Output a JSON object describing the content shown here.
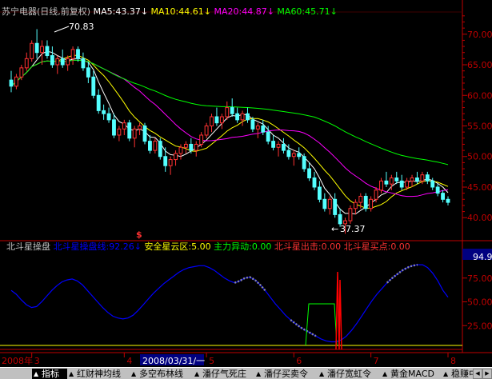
{
  "main_panel": {
    "stock_name": "苏宁电器",
    "period": "(日线,前复权)",
    "ma5": {
      "label": "MA5:",
      "value": "43.37",
      "color": "#ffffff"
    },
    "ma10": {
      "label": "MA10:",
      "value": "44.61",
      "color": "#ffff00"
    },
    "ma20": {
      "label": "MA20:",
      "value": "44.87",
      "color": "#ff00ff"
    },
    "ma60": {
      "label": "MA60:",
      "value": "45.71",
      "color": "#00ff00"
    },
    "high_marker": "70.83",
    "low_marker": "37.37",
    "signal_mark": "$",
    "y_ticks": [
      "70.00",
      "65.00",
      "60.00",
      "55.00",
      "50.00",
      "45.00",
      "40.00"
    ]
  },
  "indicator_panel": {
    "name": "北斗星操盘",
    "line_label": "北斗星操盘线:",
    "line_value": "92.26",
    "safe_label": "安全星云区:",
    "safe_value": "5.00",
    "force_label": "主力异动:",
    "force_value": "0.00",
    "exit_label": "北斗星出击:",
    "exit_value": "0.00",
    "buy_label": "北斗星买点:",
    "buy_value": "0.00",
    "current_value": "94.98",
    "y_ticks": [
      "75.00",
      "50.00",
      "25.00"
    ]
  },
  "time_axis": {
    "year_label": "2008年",
    "months": [
      "3",
      "4",
      "5",
      "6",
      "7",
      "8"
    ],
    "cursor_date": "2008/03/31/一"
  },
  "tabs": [
    {
      "label": "指标",
      "active": true
    },
    {
      "label": "红财神均线",
      "active": false
    },
    {
      "label": "多空布林线",
      "active": false
    },
    {
      "label": "潘仔气死庄",
      "active": false
    },
    {
      "label": "潘仔买卖令",
      "active": false
    },
    {
      "label": "潘仔宽虹令",
      "active": false
    },
    {
      "label": "黄金MACD",
      "active": false
    },
    {
      "label": "稳赚中长",
      "active": false
    }
  ],
  "colors": {
    "bull": "#ff3232",
    "bear": "#54ffff",
    "axis": "#c00000",
    "ma60": "#00ff00",
    "indicator_line": "#0000ff"
  },
  "chart_data": {
    "type": "candlestick",
    "title": "苏宁电器(日线,前复权)",
    "ylim": [
      36.5,
      73.5
    ],
    "indicator_ylim": [
      0,
      100
    ],
    "ohlc": [
      [
        62.5,
        64,
        60.5,
        61.5
      ],
      [
        61.5,
        63.5,
        61,
        63
      ],
      [
        63,
        65,
        62.5,
        64.5
      ],
      [
        64.5,
        67,
        64,
        66
      ],
      [
        66,
        69,
        65.5,
        68.5
      ],
      [
        68.5,
        70.83,
        66,
        67
      ],
      [
        67,
        69,
        65,
        68
      ],
      [
        68,
        69,
        66,
        66.5
      ],
      [
        66.5,
        68,
        64.5,
        65
      ],
      [
        65,
        66.5,
        63.5,
        66
      ],
      [
        66,
        67.5,
        64.5,
        65
      ],
      [
        65,
        66.5,
        64,
        66
      ],
      [
        66,
        68,
        65,
        67.5
      ],
      [
        67.5,
        68,
        65.5,
        66
      ],
      [
        66,
        67,
        64,
        64.5
      ],
      [
        64.5,
        65.5,
        62,
        63
      ],
      [
        63,
        64,
        59.5,
        60
      ],
      [
        60,
        61,
        57,
        57.5
      ],
      [
        57.5,
        58.5,
        56,
        57
      ],
      [
        57,
        58,
        55.5,
        56
      ],
      [
        56,
        57,
        53,
        53.5
      ],
      [
        53.5,
        55,
        52.5,
        54.5
      ],
      [
        54.5,
        56,
        53.5,
        55.5
      ],
      [
        55.5,
        56,
        52.5,
        53
      ],
      [
        53,
        55,
        51.5,
        54.5
      ],
      [
        54.5,
        55.5,
        53.5,
        55
      ],
      [
        55,
        55.5,
        52,
        52.5
      ],
      [
        52.5,
        53.5,
        50.5,
        51
      ],
      [
        51,
        53,
        50.5,
        52.5
      ],
      [
        52.5,
        53,
        49.5,
        50
      ],
      [
        50,
        51.5,
        47.5,
        48.5
      ],
      [
        48.5,
        50,
        47,
        49.5
      ],
      [
        49.5,
        51,
        48.5,
        50.5
      ],
      [
        50.5,
        52,
        49.5,
        51.5
      ],
      [
        51.5,
        52.5,
        50.5,
        52
      ],
      [
        52,
        53,
        50.5,
        51
      ],
      [
        51,
        52.5,
        50,
        52
      ],
      [
        52,
        54,
        51.5,
        53.5
      ],
      [
        53.5,
        55.5,
        53,
        55
      ],
      [
        55,
        57,
        54,
        56.5
      ],
      [
        56.5,
        58,
        55,
        55.5
      ],
      [
        55.5,
        57,
        54.5,
        56.5
      ],
      [
        56.5,
        59,
        56,
        58
      ],
      [
        58,
        59.5,
        56.5,
        57
      ],
      [
        57,
        58,
        55.5,
        56
      ],
      [
        56,
        57.5,
        55,
        57
      ],
      [
        57,
        58,
        55.5,
        56
      ],
      [
        56,
        56.5,
        54,
        54.5
      ],
      [
        54.5,
        55.5,
        53,
        55
      ],
      [
        55,
        56,
        53.5,
        54
      ],
      [
        54,
        55,
        52,
        52.5
      ],
      [
        52.5,
        53.5,
        51,
        51.5
      ],
      [
        51.5,
        52.5,
        50,
        52
      ],
      [
        52,
        53,
        50.5,
        51
      ],
      [
        51,
        52,
        49.5,
        50
      ],
      [
        50,
        51,
        48.5,
        50.5
      ],
      [
        50.5,
        51.5,
        49.5,
        50
      ],
      [
        50,
        50.5,
        47.5,
        48
      ],
      [
        48,
        49,
        46,
        46.5
      ],
      [
        46.5,
        47.5,
        44.5,
        45
      ],
      [
        45,
        46,
        42.5,
        43
      ],
      [
        43,
        44,
        41,
        41.5
      ],
      [
        41.5,
        43.5,
        40.5,
        43
      ],
      [
        43,
        44,
        40,
        40.5
      ],
      [
        40.5,
        41.5,
        38.5,
        39
      ],
      [
        39,
        40,
        37.37,
        39.5
      ],
      [
        39.5,
        42,
        39,
        41.5
      ],
      [
        41.5,
        43,
        40.5,
        42.5
      ],
      [
        42.5,
        44,
        41.5,
        43.5
      ],
      [
        43.5,
        44,
        41,
        41.5
      ],
      [
        41.5,
        43.5,
        41,
        43
      ],
      [
        43,
        45,
        42.5,
        44.5
      ],
      [
        44.5,
        46.5,
        44,
        46
      ],
      [
        46,
        47.5,
        45,
        45.5
      ],
      [
        45.5,
        47,
        44.5,
        46.5
      ],
      [
        46.5,
        47.5,
        45.5,
        46
      ],
      [
        46,
        47,
        44.5,
        45
      ],
      [
        45,
        46.5,
        44.5,
        46
      ],
      [
        46,
        47,
        45,
        46.5
      ],
      [
        46.5,
        47.5,
        45.5,
        46
      ],
      [
        46,
        47.5,
        45.5,
        47
      ],
      [
        47,
        47.5,
        45.5,
        46
      ],
      [
        46,
        46.5,
        44.5,
        45
      ],
      [
        45,
        45.5,
        43.5,
        44
      ],
      [
        44,
        44.5,
        42.5,
        43
      ],
      [
        43,
        43.5,
        42,
        42.5
      ]
    ],
    "series": [
      {
        "name": "MA5",
        "values": []
      },
      {
        "name": "MA10",
        "values": []
      },
      {
        "name": "MA20",
        "values": []
      },
      {
        "name": "MA60",
        "values": []
      },
      {
        "name": "北斗星操盘线",
        "values": [
          62,
          58,
          52,
          47,
          44,
          45,
          50,
          56,
          62,
          67,
          71,
          73,
          74,
          72,
          68,
          62,
          56,
          50,
          44,
          39,
          35,
          33,
          32,
          33,
          36,
          41,
          47,
          53,
          59,
          64,
          69,
          73,
          77,
          81,
          84,
          86,
          87,
          88,
          88,
          86,
          83,
          79,
          75,
          72,
          70,
          72,
          75,
          76,
          73,
          68,
          62,
          55,
          48,
          42,
          36,
          31,
          27,
          23,
          20,
          17,
          14,
          11,
          9,
          8,
          8,
          10,
          14,
          20,
          27,
          35,
          43,
          51,
          58,
          64,
          70,
          75,
          79,
          83,
          86,
          88,
          89,
          89,
          86,
          80,
          72,
          62,
          55
        ]
      }
    ]
  }
}
